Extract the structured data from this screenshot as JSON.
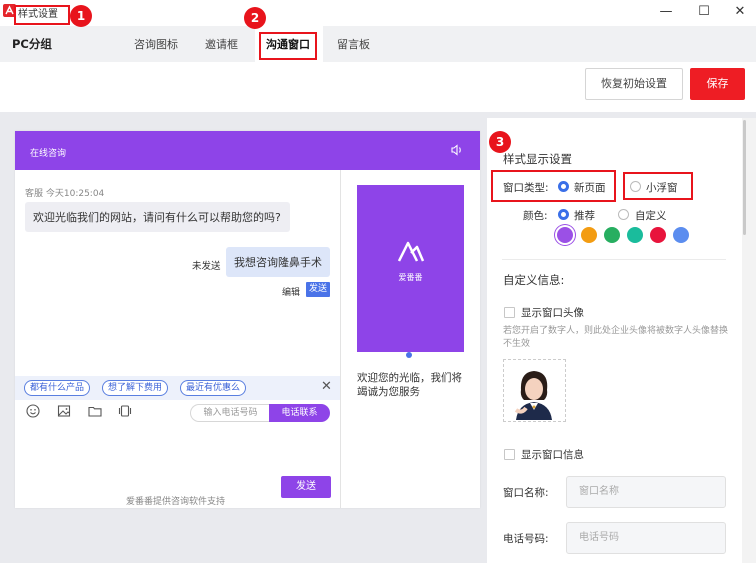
{
  "window": {
    "title": "样式设置",
    "minimize": "—",
    "maximize": "☐",
    "close": "✕"
  },
  "nav": {
    "group_label": "PC分组",
    "tabs": [
      {
        "label": "咨询图标"
      },
      {
        "label": "邀请框"
      },
      {
        "label": "沟通窗口",
        "active": true
      },
      {
        "label": "留言板"
      }
    ]
  },
  "toolbar": {
    "reset_label": "恢复初始设置",
    "save_label": "保存"
  },
  "preview": {
    "header_title": "在线咨询",
    "message_meta": "客服 今天10:25:04",
    "incoming_message": "欢迎光临我们的网站，请问有什么可以帮助您的吗?",
    "unsent_label": "未发送",
    "outgoing_message": "我想咨询隆鼻手术",
    "edit_label": "编辑",
    "send_tag": "发送",
    "quick_replies": [
      "都有什么产品",
      "想了解下费用",
      "最近有优惠么"
    ],
    "phone_placeholder": "输入电话号码",
    "call_button": "电话联系",
    "send_button": "发送",
    "powered_by": "爱番番提供咨询软件支持",
    "promo_brand": "爱番番",
    "promo_text": "欢迎您的光临，我们将竭诚为您服务",
    "accent_color": "#8e44e8"
  },
  "settings": {
    "section_title": "样式显示设置",
    "window_type_label": "窗口类型:",
    "window_type_options": [
      {
        "label": "新页面",
        "selected": true
      },
      {
        "label": "小浮窗",
        "selected": false
      }
    ],
    "color_label": "颜色:",
    "color_options": [
      {
        "label": "推荐",
        "selected": true
      },
      {
        "label": "自定义",
        "selected": false
      }
    ],
    "swatches": [
      "#9b50e6",
      "#f39c12",
      "#27ae60",
      "#1abc9c",
      "#e8143c",
      "#5b8def"
    ],
    "custom_info_title": "自定义信息:",
    "show_avatar_label": "显示窗口头像",
    "avatar_hint": "若您开启了数字人，则此处企业头像将被数字人头像替换不生效",
    "show_info_label": "显示窗口信息",
    "window_name_label": "窗口名称:",
    "window_name_placeholder": "窗口名称",
    "phone_label": "电话号码:",
    "phone_placeholder": "电话号码"
  },
  "annotations": [
    "1",
    "2",
    "3"
  ],
  "colors": {
    "save": "#ee1d24",
    "annotation": "#e8141c",
    "radio_on": "#3a6fe8"
  }
}
